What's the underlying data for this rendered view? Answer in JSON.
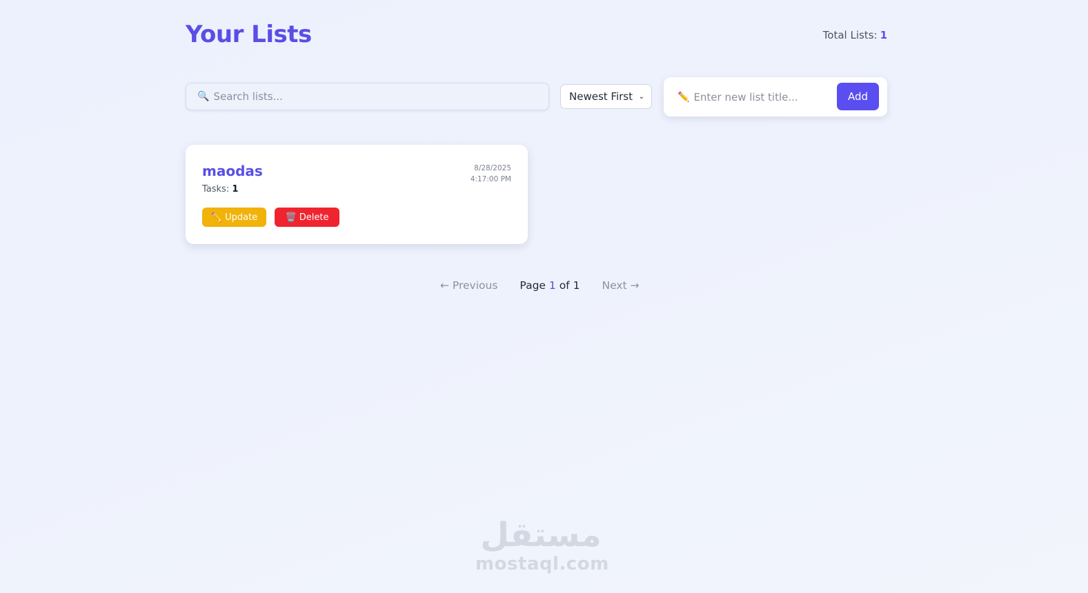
{
  "header": {
    "title": "Your Lists",
    "total_label": "Total Lists:",
    "total_count": "1"
  },
  "search": {
    "icon": "search-icon",
    "placeholder": "Search lists...",
    "value": ""
  },
  "sort": {
    "selected": "Newest First"
  },
  "new_list": {
    "icon": "pencil-icon",
    "placeholder": "Enter new list title...",
    "value": "",
    "add_label": "Add"
  },
  "lists": [
    {
      "title": "maodas",
      "tasks_label": "Tasks:",
      "tasks_count": "1",
      "date": "8/28/2025",
      "time": "4:17:00 PM",
      "update_label": "✏️ Update",
      "delete_label": "🗑️ Delete"
    }
  ],
  "pagination": {
    "prev_label": "← Previous",
    "page_word": "Page",
    "current": "1",
    "of_word": "of",
    "total": "1",
    "next_label": "Next →"
  },
  "watermark": {
    "arabic": "مستقل",
    "latin": "mostaql.com"
  },
  "colors": {
    "accent": "#5a4ee6",
    "update": "#f1b20a",
    "delete": "#f0242f"
  }
}
